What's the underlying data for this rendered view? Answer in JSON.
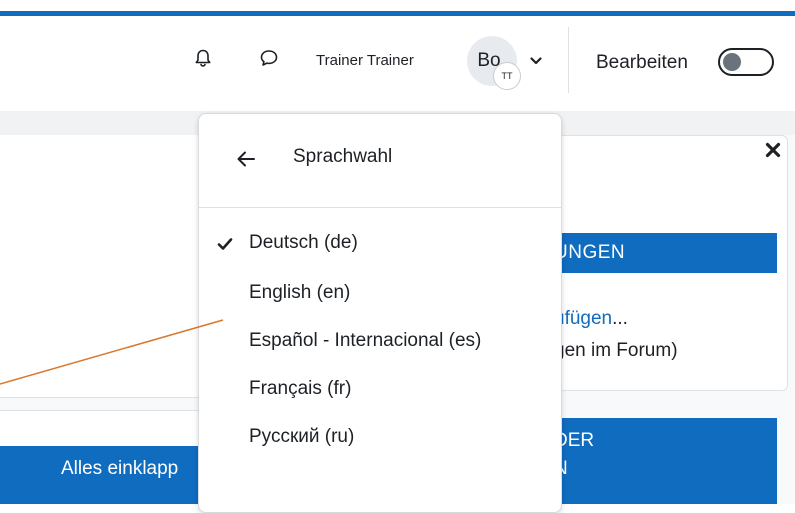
{
  "header": {
    "user_name": "Trainer Trainer",
    "avatar_initials": "Bo",
    "avatar_badge": "TT",
    "edit_mode_label": "Bearbeiten",
    "edit_mode_on": false,
    "icons": [
      "bell-icon",
      "chat-bubble-icon",
      "chevron-down-icon"
    ]
  },
  "language_menu": {
    "title": "Sprachwahl",
    "back_icon": "arrow-left-icon",
    "selected": "Deutsch (de)",
    "items": [
      {
        "label": "Deutsch (de)",
        "selected": true
      },
      {
        "label": "English (en)",
        "selected": false
      },
      {
        "label": "Español - Internacional (es)",
        "selected": false
      },
      {
        "label": "Français (fr)",
        "selected": false
      },
      {
        "label": "Русский (ru)",
        "selected": false
      }
    ]
  },
  "left_panel": {
    "collapse_all_label": "Alles einklapp"
  },
  "right_panel": {
    "close_icon": "close-icon",
    "block1_heading": "UNGEN",
    "block1_link": "ufügen",
    "block1_link_suffix": "...",
    "block1_text": "gen im Forum)",
    "block2_heading_line1": "DER",
    "block2_heading_line2": "N"
  },
  "colors": {
    "brand": "#0f6cbf",
    "annotation": "#d9772b",
    "text": "#1d2125"
  }
}
